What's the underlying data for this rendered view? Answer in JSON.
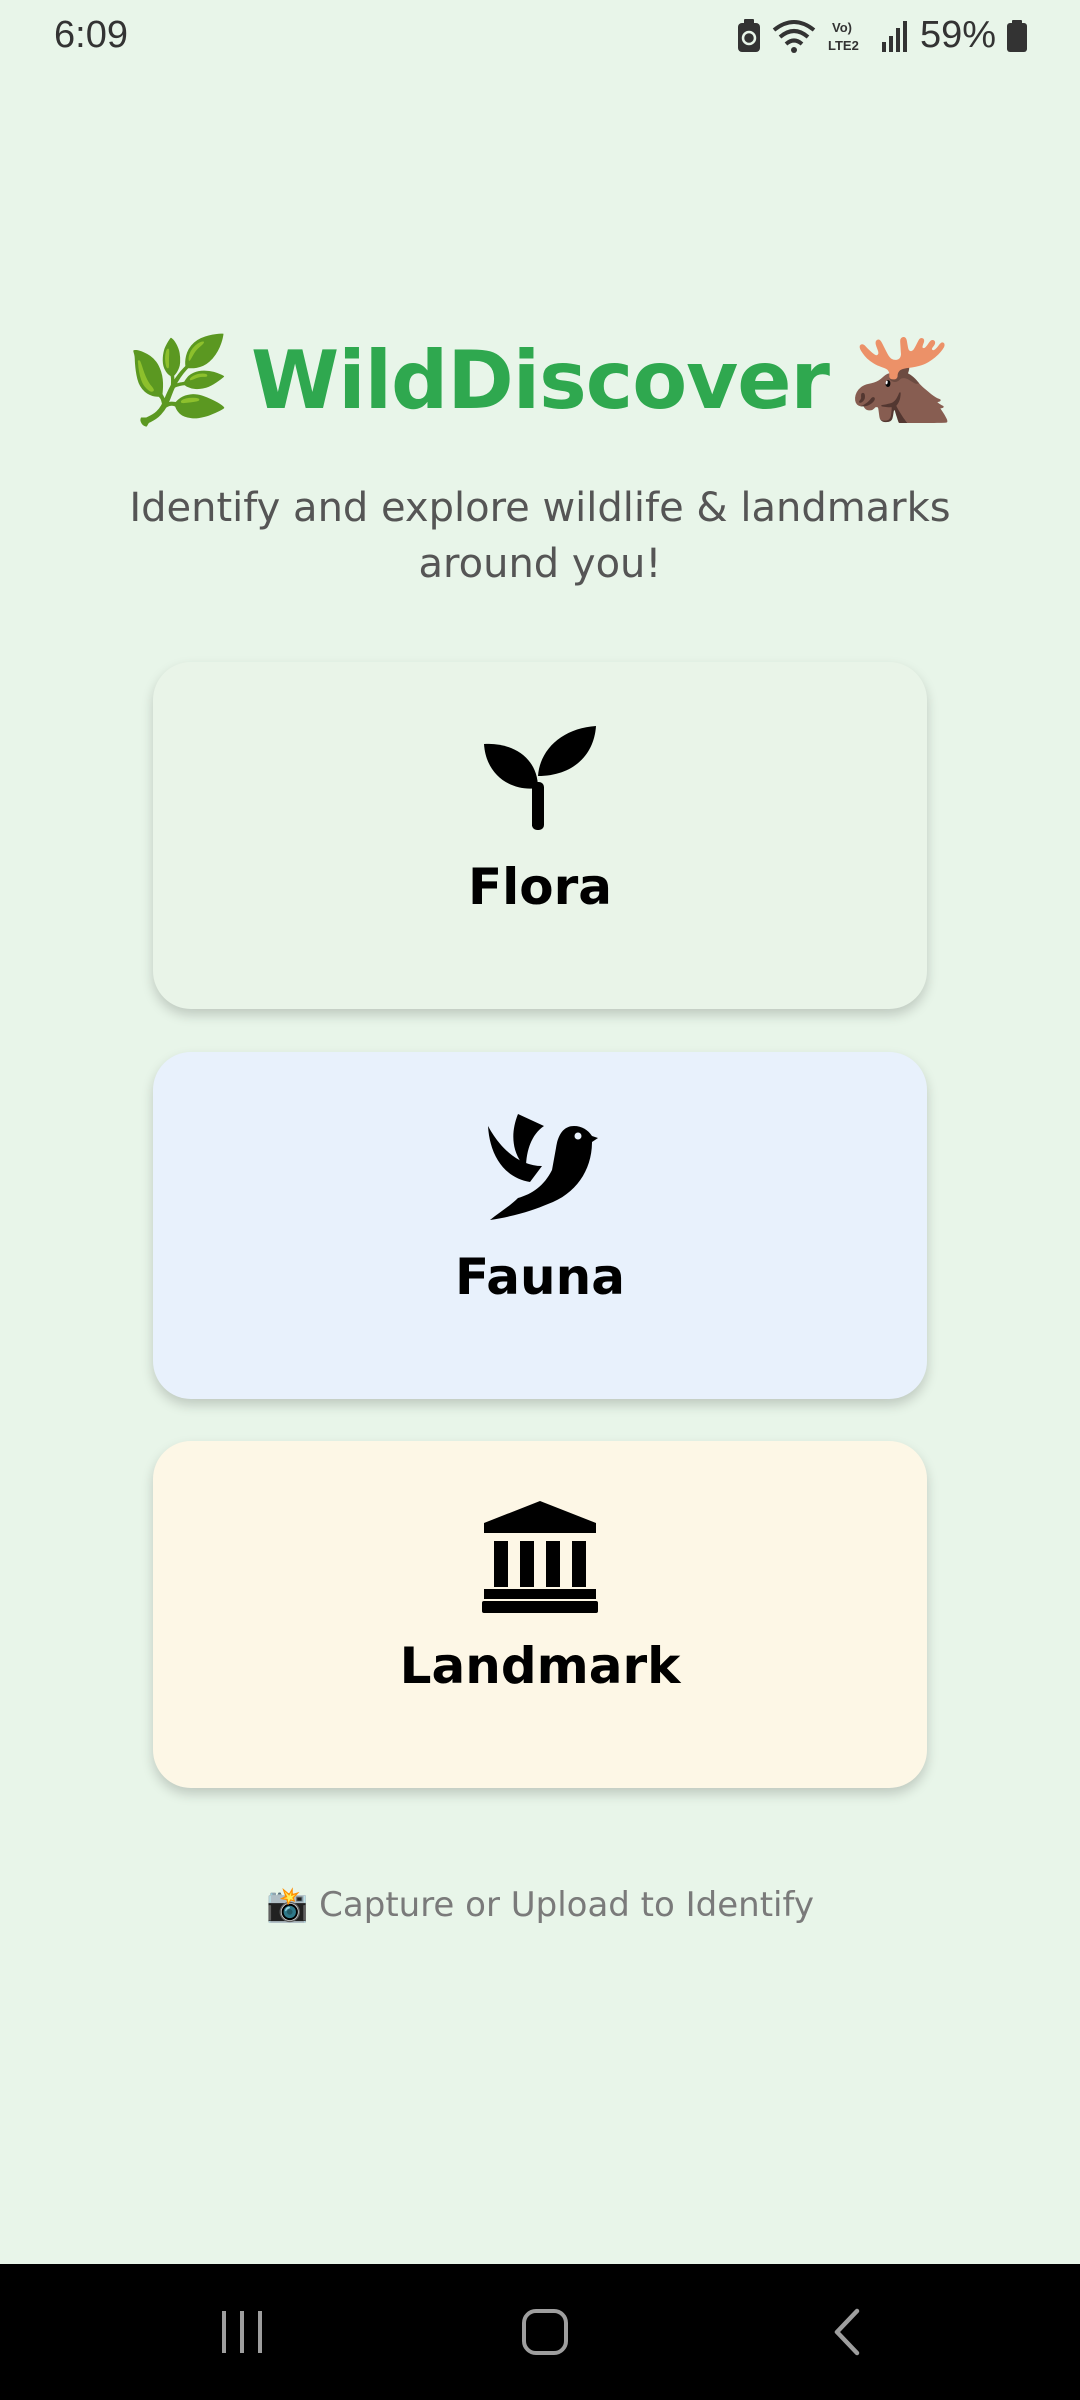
{
  "status_bar": {
    "time": "6:09",
    "battery_percent": "59%",
    "network_label": "Vo) LTE2"
  },
  "header": {
    "leading_emoji": "🌿",
    "title": "WildDiscover",
    "trailing_emoji": "🫎",
    "subtitle": "Identify and explore wildlife & landmarks around you!",
    "title_color": "#2fa84f"
  },
  "cards": [
    {
      "label": "Flora",
      "icon": "sprout-icon",
      "color": "#e9f4e8"
    },
    {
      "label": "Fauna",
      "icon": "dove-icon",
      "color": "#e8f1fc"
    },
    {
      "label": "Landmark",
      "icon": "landmark-icon",
      "color": "#fdf7e6"
    }
  ],
  "hint": {
    "text": "📸 Capture or Upload to Identify"
  },
  "nav": {
    "recents": "recents-icon",
    "home": "home-icon",
    "back": "back-icon"
  }
}
